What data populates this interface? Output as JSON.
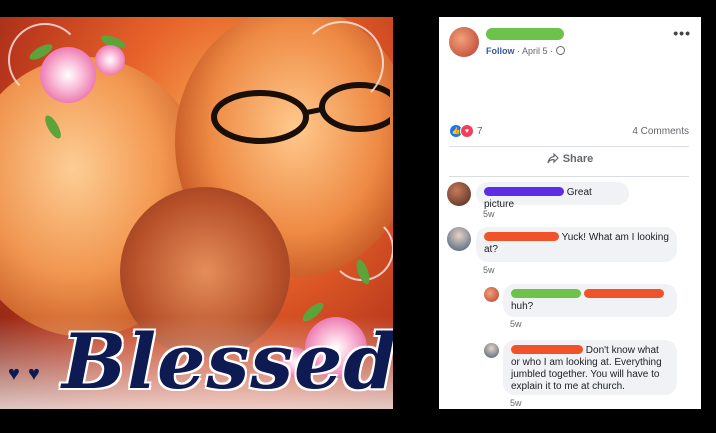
{
  "photo": {
    "overlay_text": "Blessed",
    "decoration_icons": [
      "heart-icon",
      "flower-icon",
      "swirl-icon"
    ]
  },
  "post": {
    "follow_label": "Follow",
    "separator": "·",
    "date": "April 5",
    "separator2": "·",
    "privacy_icon": "globe-icon",
    "more_label": "•••",
    "reaction_count": "7",
    "comments_label": "4 Comments",
    "share_label": "Share"
  },
  "comments": [
    {
      "text": "Great picture",
      "time": "5w",
      "redaction_color": "#5b2ee6"
    },
    {
      "text": "Yuck! What am I looking at?",
      "time": "5w",
      "redaction_color": "#f0532a"
    },
    {
      "text": "huh?",
      "time": "5w",
      "redaction_color": "#6cc24a"
    },
    {
      "text": "Don't know what or who I am looking at. Everything jumbled together. You will have to explain it to me at church.",
      "time": "5w",
      "redaction_color": "#f0532a"
    }
  ],
  "colors": {
    "redact_green": "#6cc24a",
    "redact_red": "#f0532a",
    "redact_purple": "#5b2ee6",
    "link_blue": "#385898"
  }
}
